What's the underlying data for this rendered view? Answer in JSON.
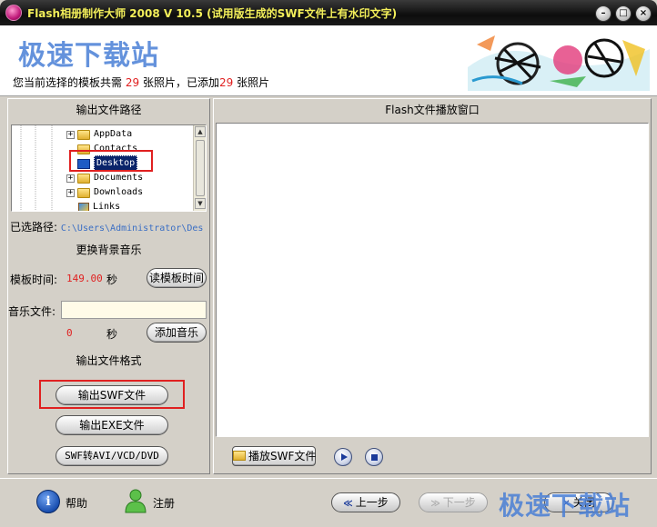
{
  "window": {
    "title": "Flash相册制作大师 2008 V 10.5 (试用版生成的SWF文件上有水印文字)",
    "minimize_glyph": "–",
    "maximize_glyph": "□",
    "close_glyph": "×"
  },
  "header": {
    "watermark": "极速下载站",
    "info_prefix": "您当前选择的模板共需",
    "required_count": "29",
    "info_mid": "张照片，已添加",
    "added_count": "29",
    "info_suffix": "张照片"
  },
  "left_panel": {
    "output_path_heading": "输出文件路径",
    "tree_items": [
      {
        "label": "AppData"
      },
      {
        "label": "Contacts"
      },
      {
        "label": "Desktop"
      },
      {
        "label": "Documents"
      },
      {
        "label": "Downloads"
      },
      {
        "label": "Links"
      }
    ],
    "selected_path_label": "已选路径:",
    "selected_path_value": "C:\\Users\\Administrator\\Des",
    "music_heading": "更换背景音乐",
    "template_time_label": "模板时间:",
    "template_time_value": "149.00",
    "seconds_unit": "秒",
    "read_template_time_button": "读模板时间",
    "music_file_label": "音乐文件:",
    "music_file_value": "",
    "music_seconds_value": "0",
    "add_music_button": "添加音乐",
    "output_format_heading": "输出文件格式",
    "export_swf_button": "输出SWF文件",
    "export_exe_button": "输出EXE文件",
    "swf_convert_button": "SWF转AVI/VCD/DVD"
  },
  "right_panel": {
    "player_heading": "Flash文件播放窗口",
    "play_swf_button": "播放SWF文件"
  },
  "bottom_bar": {
    "help_label": "帮助",
    "help_glyph": "i",
    "register_label": "注册",
    "prev_button": "上一步",
    "next_button": "下一步",
    "close_button": "关闭",
    "watermark": "极速下载站"
  },
  "colors": {
    "highlight_red": "#e02020",
    "title_text": "#f3ef5a",
    "watermark_blue": "#4a7fd6"
  }
}
